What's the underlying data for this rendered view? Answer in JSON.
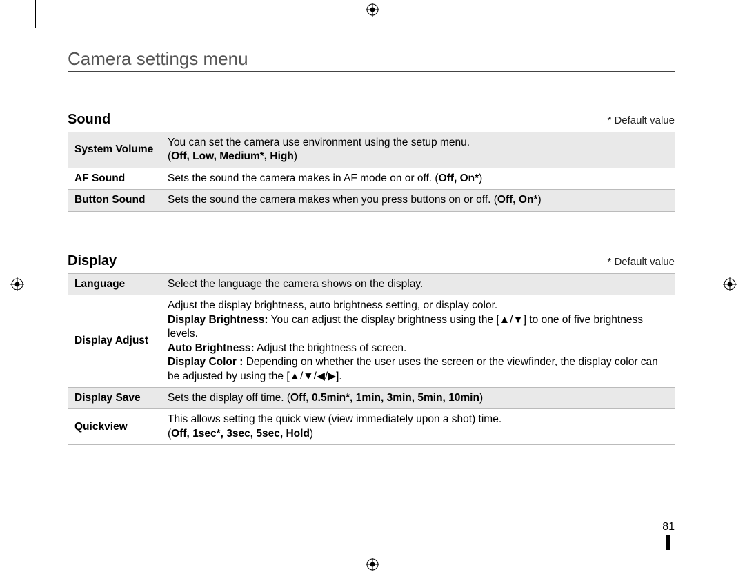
{
  "title": "Camera settings menu",
  "default_note": "* Default value",
  "page_number": "81",
  "sections": {
    "sound": {
      "title": "Sound",
      "rows": {
        "system_volume": {
          "label": "System Volume",
          "line1": "You can set the camera use environment using the setup menu.",
          "options_open": "(",
          "options": "Off, Low, Medium*, High",
          "options_close": ")"
        },
        "af_sound": {
          "label": "AF Sound",
          "text": "Sets the sound the camera makes in AF mode on or off. (",
          "options": "Off, On*",
          "text_close": ")"
        },
        "button_sound": {
          "label": "Button Sound",
          "text": "Sets the sound the camera makes when you press buttons on or off. (",
          "options": "Off, On*",
          "text_close": ")"
        }
      }
    },
    "display": {
      "title": "Display",
      "rows": {
        "language": {
          "label": "Language",
          "text": "Select the language the camera shows on the display."
        },
        "display_adjust": {
          "label": "Display Adjust",
          "intro": "Adjust the display brightness, auto brightness setting, or display color.",
          "brightness_label": "Display Brightness:",
          "brightness_text_a": " You can adjust the display brightness using the [",
          "brightness_icons": "▲/▼",
          "brightness_text_b": "] to one of five brightness levels.",
          "auto_label": "Auto Brightness:",
          "auto_text": " Adjust the brightness of screen.",
          "color_label": "Display Color :",
          "color_text_a": " Depending on whether the user uses the screen or the viewfinder, the display color can be adjusted by using the [",
          "color_icons": "▲/▼/◀/▶",
          "color_text_b": "]."
        },
        "display_save": {
          "label": "Display Save",
          "text": "Sets the display off time. (",
          "options": "Off, 0.5min*, 1min, 3min, 5min, 10min",
          "text_close": ")"
        },
        "quickview": {
          "label": "Quickview",
          "text": "This allows setting the quick view (view immediately upon a shot) time.",
          "options_open": "(",
          "options": "Off, 1sec*, 3sec, 5sec, Hold",
          "options_close": ")"
        }
      }
    }
  }
}
